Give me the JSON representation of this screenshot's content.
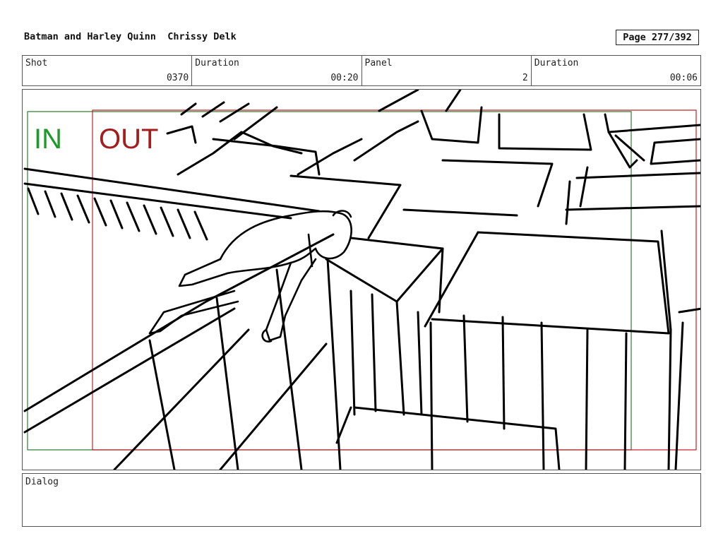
{
  "header": {
    "title": "Batman and Harley Quinn",
    "artist": "Chrissy Delk",
    "page": "Page 277/392"
  },
  "info": {
    "shot_label": "Shot",
    "shot_value": "0370",
    "duration1_label": "Duration",
    "duration1_value": "00:20",
    "panel_label": "Panel",
    "panel_value": "2",
    "duration2_label": "Duration",
    "duration2_value": "00:06"
  },
  "frame": {
    "in_label": "IN",
    "out_label": "OUT",
    "in_color": "#1f9a2a",
    "out_color": "#a51c1c"
  },
  "dialog": {
    "label": "Dialog",
    "text": ""
  }
}
